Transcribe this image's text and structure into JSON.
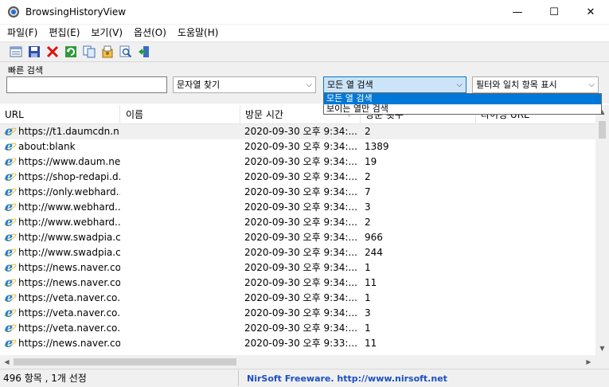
{
  "window": {
    "title": "BrowsingHistoryView",
    "minimize": "—",
    "maximize": "☐",
    "close": "✕"
  },
  "menu": [
    "파일(F)",
    "편집(E)",
    "보기(V)",
    "옵션(O)",
    "도움말(H)"
  ],
  "toolbar": {
    "icons": [
      "properties-icon",
      "save-icon",
      "delete-icon",
      "refresh-icon",
      "copy-icon",
      "html-report-icon",
      "find-icon",
      "exit-icon"
    ]
  },
  "quick_search": {
    "label": "빠른 검색",
    "value": "",
    "mode": "문자열 찾기",
    "scope": "모든 열 검색",
    "filter": "필터와 일치 항목 표시",
    "scope_options": [
      "모든 열 검색",
      "보이는 열만 검색"
    ]
  },
  "columns": [
    "URL",
    "이름",
    "방문 시간",
    "방문 횟수",
    "타이핑 URL"
  ],
  "rows": [
    {
      "url": "https://t1.daumcdn.n...",
      "title": "",
      "time": "2020-09-30 오후 9:34:...",
      "count": "2",
      "selected": true
    },
    {
      "url": "about:blank",
      "title": "",
      "time": "2020-09-30 오후 9:34:...",
      "count": "1389"
    },
    {
      "url": "https://www.daum.net/",
      "title": "",
      "time": "2020-09-30 오후 9:34:...",
      "count": "19"
    },
    {
      "url": "https://shop-redapi.d...",
      "title": "",
      "time": "2020-09-30 오후 9:34:...",
      "count": "2"
    },
    {
      "url": "https://only.webhard....",
      "title": "",
      "time": "2020-09-30 오후 9:34:...",
      "count": "7"
    },
    {
      "url": "http://www.webhard....",
      "title": "",
      "time": "2020-09-30 오후 9:34:...",
      "count": "3"
    },
    {
      "url": "http://www.webhard....",
      "title": "",
      "time": "2020-09-30 오후 9:34:...",
      "count": "2"
    },
    {
      "url": "http://www.swadpia.c...",
      "title": "",
      "time": "2020-09-30 오후 9:34:...",
      "count": "966"
    },
    {
      "url": "http://www.swadpia.c...",
      "title": "",
      "time": "2020-09-30 오후 9:34:...",
      "count": "244"
    },
    {
      "url": "https://news.naver.co...",
      "title": "",
      "time": "2020-09-30 오후 9:34:...",
      "count": "1"
    },
    {
      "url": "https://news.naver.co...",
      "title": "",
      "time": "2020-09-30 오후 9:34:...",
      "count": "11"
    },
    {
      "url": "https://veta.naver.co...",
      "title": "",
      "time": "2020-09-30 오후 9:34:...",
      "count": "1"
    },
    {
      "url": "https://veta.naver.co...",
      "title": "",
      "time": "2020-09-30 오후 9:34:...",
      "count": "3"
    },
    {
      "url": "https://veta.naver.co...",
      "title": "",
      "time": "2020-09-30 오후 9:34:...",
      "count": "1"
    },
    {
      "url": "https://news.naver.co...",
      "title": "",
      "time": "2020-09-30 오후 9:33:...",
      "count": "11"
    }
  ],
  "status": {
    "count_text": "496 항목 , 1개 선정",
    "link_text": "NirSoft Freeware.  http://www.nirsoft.net"
  },
  "colors": {
    "link": "#1b4fc1",
    "selection": "#0078d7",
    "active_combo": "#cce4f7"
  }
}
